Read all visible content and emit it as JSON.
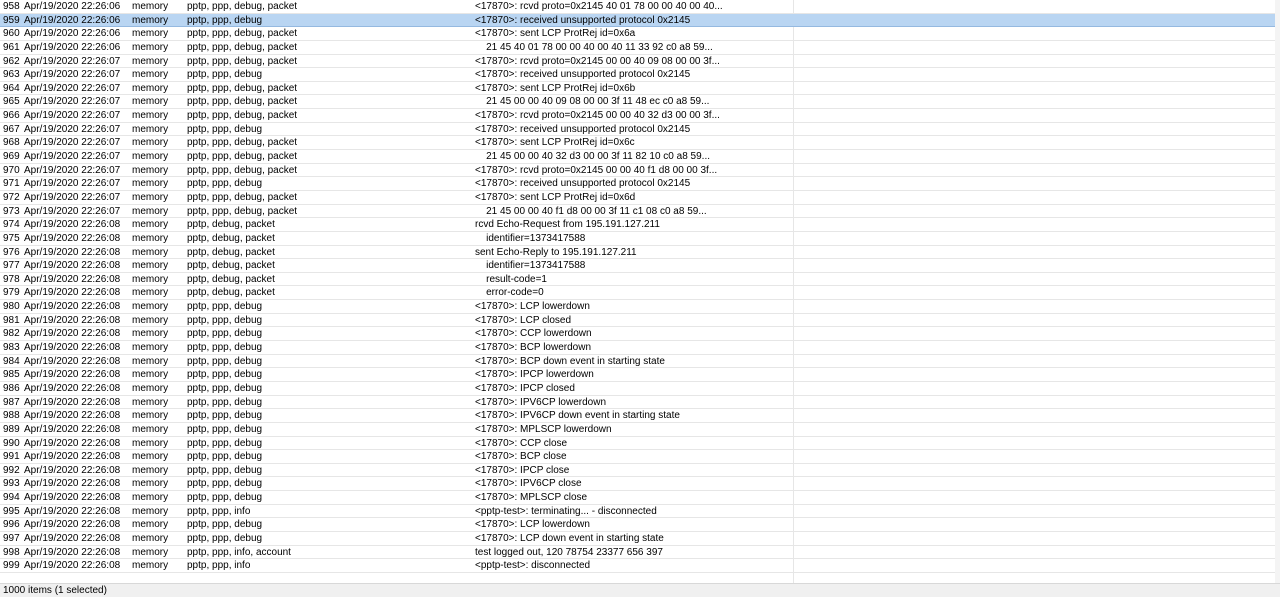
{
  "log": {
    "rows": [
      {
        "num": "958",
        "time": "Apr/19/2020 22:26:06",
        "buffer": "memory",
        "topics": "pptp, ppp, debug, packet",
        "message": "<17870>: rcvd proto=0x2145 40 01 78 00 00 40 00 40..."
      },
      {
        "num": "959",
        "time": "Apr/19/2020 22:26:06",
        "buffer": "memory",
        "topics": "pptp, ppp, debug",
        "message": "<17870>: received unsupported protocol 0x2145",
        "selected": true
      },
      {
        "num": "960",
        "time": "Apr/19/2020 22:26:06",
        "buffer": "memory",
        "topics": "pptp, ppp, debug, packet",
        "message": "<17870>: sent LCP ProtRej id=0x6a"
      },
      {
        "num": "961",
        "time": "Apr/19/2020 22:26:06",
        "buffer": "memory",
        "topics": "pptp, ppp, debug, packet",
        "message": "    21 45 40 01 78 00 00 40 00 40 11 33 92 c0 a8 59..."
      },
      {
        "num": "962",
        "time": "Apr/19/2020 22:26:07",
        "buffer": "memory",
        "topics": "pptp, ppp, debug, packet",
        "message": "<17870>: rcvd proto=0x2145 00 00 40 09 08 00 00 3f..."
      },
      {
        "num": "963",
        "time": "Apr/19/2020 22:26:07",
        "buffer": "memory",
        "topics": "pptp, ppp, debug",
        "message": "<17870>: received unsupported protocol 0x2145"
      },
      {
        "num": "964",
        "time": "Apr/19/2020 22:26:07",
        "buffer": "memory",
        "topics": "pptp, ppp, debug, packet",
        "message": "<17870>: sent LCP ProtRej id=0x6b"
      },
      {
        "num": "965",
        "time": "Apr/19/2020 22:26:07",
        "buffer": "memory",
        "topics": "pptp, ppp, debug, packet",
        "message": "    21 45 00 00 40 09 08 00 00 3f 11 48 ec c0 a8 59..."
      },
      {
        "num": "966",
        "time": "Apr/19/2020 22:26:07",
        "buffer": "memory",
        "topics": "pptp, ppp, debug, packet",
        "message": "<17870>: rcvd proto=0x2145 00 00 40 32 d3 00 00 3f..."
      },
      {
        "num": "967",
        "time": "Apr/19/2020 22:26:07",
        "buffer": "memory",
        "topics": "pptp, ppp, debug",
        "message": "<17870>: received unsupported protocol 0x2145"
      },
      {
        "num": "968",
        "time": "Apr/19/2020 22:26:07",
        "buffer": "memory",
        "topics": "pptp, ppp, debug, packet",
        "message": "<17870>: sent LCP ProtRej id=0x6c"
      },
      {
        "num": "969",
        "time": "Apr/19/2020 22:26:07",
        "buffer": "memory",
        "topics": "pptp, ppp, debug, packet",
        "message": "    21 45 00 00 40 32 d3 00 00 3f 11 82 10 c0 a8 59..."
      },
      {
        "num": "970",
        "time": "Apr/19/2020 22:26:07",
        "buffer": "memory",
        "topics": "pptp, ppp, debug, packet",
        "message": "<17870>: rcvd proto=0x2145 00 00 40 f1 d8 00 00 3f..."
      },
      {
        "num": "971",
        "time": "Apr/19/2020 22:26:07",
        "buffer": "memory",
        "topics": "pptp, ppp, debug",
        "message": "<17870>: received unsupported protocol 0x2145"
      },
      {
        "num": "972",
        "time": "Apr/19/2020 22:26:07",
        "buffer": "memory",
        "topics": "pptp, ppp, debug, packet",
        "message": "<17870>: sent LCP ProtRej id=0x6d"
      },
      {
        "num": "973",
        "time": "Apr/19/2020 22:26:07",
        "buffer": "memory",
        "topics": "pptp, ppp, debug, packet",
        "message": "    21 45 00 00 40 f1 d8 00 00 3f 11 c1 08 c0 a8 59..."
      },
      {
        "num": "974",
        "time": "Apr/19/2020 22:26:08",
        "buffer": "memory",
        "topics": "pptp, debug, packet",
        "message": "rcvd Echo-Request from 195.191.127.211"
      },
      {
        "num": "975",
        "time": "Apr/19/2020 22:26:08",
        "buffer": "memory",
        "topics": "pptp, debug, packet",
        "message": "    identifier=1373417588"
      },
      {
        "num": "976",
        "time": "Apr/19/2020 22:26:08",
        "buffer": "memory",
        "topics": "pptp, debug, packet",
        "message": "sent Echo-Reply to 195.191.127.211"
      },
      {
        "num": "977",
        "time": "Apr/19/2020 22:26:08",
        "buffer": "memory",
        "topics": "pptp, debug, packet",
        "message": "    identifier=1373417588"
      },
      {
        "num": "978",
        "time": "Apr/19/2020 22:26:08",
        "buffer": "memory",
        "topics": "pptp, debug, packet",
        "message": "    result-code=1"
      },
      {
        "num": "979",
        "time": "Apr/19/2020 22:26:08",
        "buffer": "memory",
        "topics": "pptp, debug, packet",
        "message": "    error-code=0"
      },
      {
        "num": "980",
        "time": "Apr/19/2020 22:26:08",
        "buffer": "memory",
        "topics": "pptp, ppp, debug",
        "message": "<17870>: LCP lowerdown"
      },
      {
        "num": "981",
        "time": "Apr/19/2020 22:26:08",
        "buffer": "memory",
        "topics": "pptp, ppp, debug",
        "message": "<17870>: LCP closed"
      },
      {
        "num": "982",
        "time": "Apr/19/2020 22:26:08",
        "buffer": "memory",
        "topics": "pptp, ppp, debug",
        "message": "<17870>: CCP lowerdown"
      },
      {
        "num": "983",
        "time": "Apr/19/2020 22:26:08",
        "buffer": "memory",
        "topics": "pptp, ppp, debug",
        "message": "<17870>: BCP lowerdown"
      },
      {
        "num": "984",
        "time": "Apr/19/2020 22:26:08",
        "buffer": "memory",
        "topics": "pptp, ppp, debug",
        "message": "<17870>: BCP down event in starting state"
      },
      {
        "num": "985",
        "time": "Apr/19/2020 22:26:08",
        "buffer": "memory",
        "topics": "pptp, ppp, debug",
        "message": "<17870>: IPCP lowerdown"
      },
      {
        "num": "986",
        "time": "Apr/19/2020 22:26:08",
        "buffer": "memory",
        "topics": "pptp, ppp, debug",
        "message": "<17870>: IPCP closed"
      },
      {
        "num": "987",
        "time": "Apr/19/2020 22:26:08",
        "buffer": "memory",
        "topics": "pptp, ppp, debug",
        "message": "<17870>: IPV6CP lowerdown"
      },
      {
        "num": "988",
        "time": "Apr/19/2020 22:26:08",
        "buffer": "memory",
        "topics": "pptp, ppp, debug",
        "message": "<17870>: IPV6CP down event in starting state"
      },
      {
        "num": "989",
        "time": "Apr/19/2020 22:26:08",
        "buffer": "memory",
        "topics": "pptp, ppp, debug",
        "message": "<17870>: MPLSCP lowerdown"
      },
      {
        "num": "990",
        "time": "Apr/19/2020 22:26:08",
        "buffer": "memory",
        "topics": "pptp, ppp, debug",
        "message": "<17870>: CCP close"
      },
      {
        "num": "991",
        "time": "Apr/19/2020 22:26:08",
        "buffer": "memory",
        "topics": "pptp, ppp, debug",
        "message": "<17870>: BCP close"
      },
      {
        "num": "992",
        "time": "Apr/19/2020 22:26:08",
        "buffer": "memory",
        "topics": "pptp, ppp, debug",
        "message": "<17870>: IPCP close"
      },
      {
        "num": "993",
        "time": "Apr/19/2020 22:26:08",
        "buffer": "memory",
        "topics": "pptp, ppp, debug",
        "message": "<17870>: IPV6CP close"
      },
      {
        "num": "994",
        "time": "Apr/19/2020 22:26:08",
        "buffer": "memory",
        "topics": "pptp, ppp, debug",
        "message": "<17870>: MPLSCP close"
      },
      {
        "num": "995",
        "time": "Apr/19/2020 22:26:08",
        "buffer": "memory",
        "topics": "pptp, ppp, info",
        "message": "<pptp-test>: terminating... - disconnected"
      },
      {
        "num": "996",
        "time": "Apr/19/2020 22:26:08",
        "buffer": "memory",
        "topics": "pptp, ppp, debug",
        "message": "<17870>: LCP lowerdown"
      },
      {
        "num": "997",
        "time": "Apr/19/2020 22:26:08",
        "buffer": "memory",
        "topics": "pptp, ppp, debug",
        "message": "<17870>: LCP down event in starting state"
      },
      {
        "num": "998",
        "time": "Apr/19/2020 22:26:08",
        "buffer": "memory",
        "topics": "pptp, ppp, info, account",
        "message": "test logged out, 120 78754 23377 656 397"
      },
      {
        "num": "999",
        "time": "Apr/19/2020 22:26:08",
        "buffer": "memory",
        "topics": "pptp, ppp, info",
        "message": "<pptp-test>: disconnected"
      }
    ]
  },
  "status": {
    "text": "1000 items (1 selected)"
  }
}
